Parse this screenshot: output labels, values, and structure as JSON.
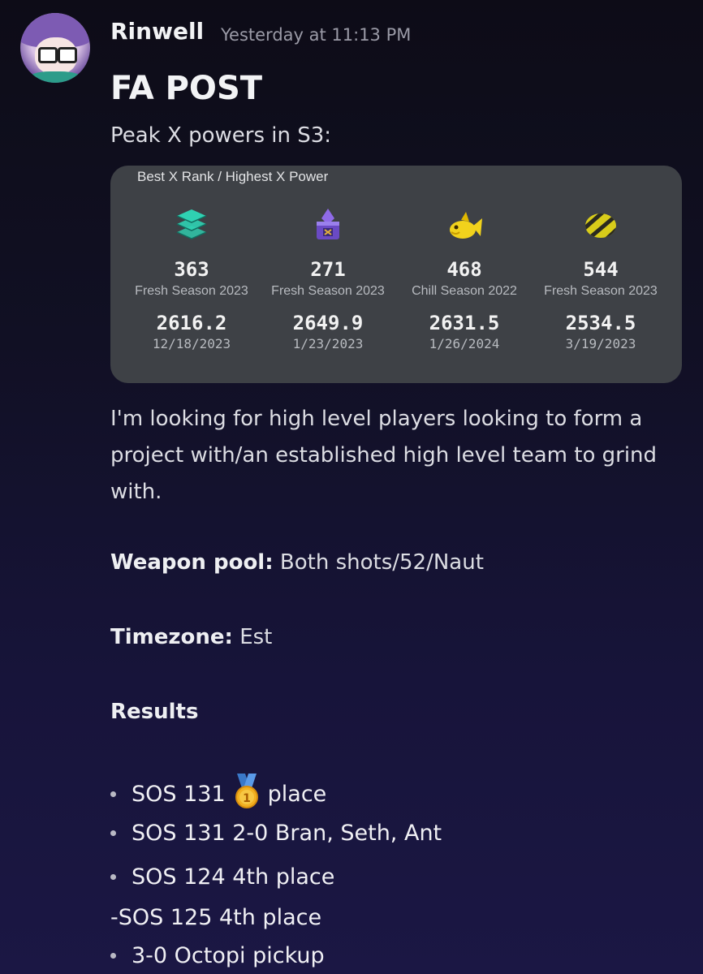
{
  "message": {
    "username": "Rinwell",
    "timestamp": "Yesterday at 11:13 PM",
    "title": "FA POST",
    "subtitle": "Peak X powers in S3:",
    "card": {
      "header": "Best X Rank / Highest X Power",
      "columns": [
        {
          "icon": "tower-icon",
          "rank": "363",
          "season": "Fresh Season 2023",
          "power": "2616.2",
          "date": "12/18/2023",
          "color": "#2fd1b2"
        },
        {
          "icon": "rainmaker-pedestal-icon",
          "rank": "271",
          "season": "Fresh Season 2023",
          "power": "2649.9",
          "date": "1/23/2023",
          "color": "#7a58d6"
        },
        {
          "icon": "fish-icon",
          "rank": "468",
          "season": "Chill Season 2022",
          "power": "2631.5",
          "date": "1/26/2024",
          "color": "#f1d21c"
        },
        {
          "icon": "clam-icon",
          "rank": "544",
          "season": "Fresh Season 2023",
          "power": "2534.5",
          "date": "3/19/2023",
          "color": "#d8cc1a"
        }
      ]
    },
    "body": "I'm looking for high level players looking to form a project with/an established high level team to grind with.",
    "weapon_label": "Weapon pool:",
    "weapon_value": "Both shots/52/Naut",
    "timezone_label": "Timezone:",
    "timezone_value": "Est",
    "results_label": "Results",
    "results": [
      {
        "before": "SOS 131",
        "medal": "1st-place-medal-icon",
        "after": "place"
      },
      {
        "text": "SOS 131 2-0 Bran, Seth, Ant"
      },
      {
        "text": "SOS 124 4th place"
      },
      {
        "text": "-SOS 125 4th place"
      },
      {
        "text": "3-0 Octopi pickup"
      }
    ]
  }
}
